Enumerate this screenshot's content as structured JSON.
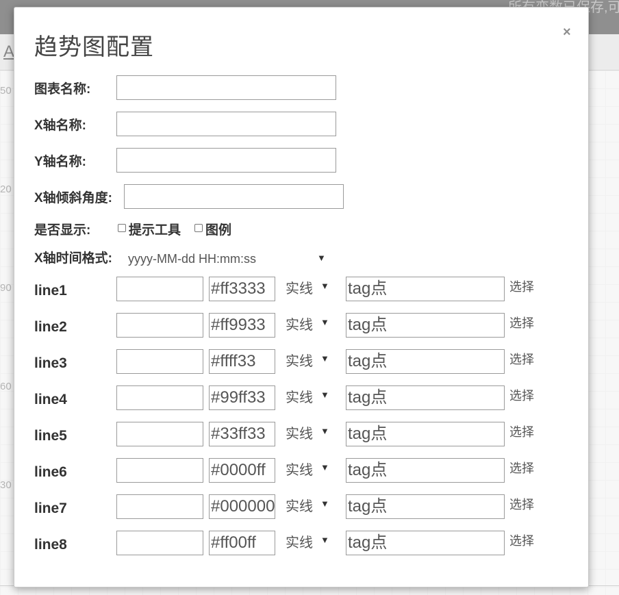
{
  "background": {
    "ghost_text": "所有变数已保存,可",
    "subbar_letter": "A",
    "y_ticks": [
      "50",
      "20",
      "90",
      "60",
      "30"
    ]
  },
  "modal": {
    "title": "趋势图配置",
    "close_icon": "×",
    "fields": {
      "chart_name_label": "图表名称:",
      "chart_name_value": "",
      "x_axis_label": "X轴名称:",
      "x_axis_value": "",
      "y_axis_label": "Y轴名称:",
      "y_axis_value": "",
      "x_tilt_label": "X轴倾斜角度:",
      "x_tilt_value": "",
      "display_label": "是否显示:",
      "tooltip_label": "提示工具",
      "legend_label": "图例",
      "time_format_label": "X轴时间格式:",
      "time_format_value": "yyyy-MM-dd HH:mm:ss"
    },
    "lines": [
      {
        "label": "line1",
        "name": "",
        "color": "#ff3333",
        "style": "实线",
        "tag_placeholder": "tag点",
        "choose": "选择"
      },
      {
        "label": "line2",
        "name": "",
        "color": "#ff9933",
        "style": "实线",
        "tag_placeholder": "tag点",
        "choose": "选择"
      },
      {
        "label": "line3",
        "name": "",
        "color": "#ffff33",
        "style": "实线",
        "tag_placeholder": "tag点",
        "choose": "选择"
      },
      {
        "label": "line4",
        "name": "",
        "color": "#99ff33",
        "style": "实线",
        "tag_placeholder": "tag点",
        "choose": "选择"
      },
      {
        "label": "line5",
        "name": "",
        "color": "#33ff33",
        "style": "实线",
        "tag_placeholder": "tag点",
        "choose": "选择"
      },
      {
        "label": "line6",
        "name": "",
        "color": "#0000ff",
        "style": "实线",
        "tag_placeholder": "tag点",
        "choose": "选择"
      },
      {
        "label": "line7",
        "name": "",
        "color": "#000000",
        "style": "实线",
        "tag_placeholder": "tag点",
        "choose": "选择"
      },
      {
        "label": "line8",
        "name": "",
        "color": "#ff00ff",
        "style": "实线",
        "tag_placeholder": "tag点",
        "choose": "选择"
      }
    ],
    "caret_icon": "▼"
  }
}
